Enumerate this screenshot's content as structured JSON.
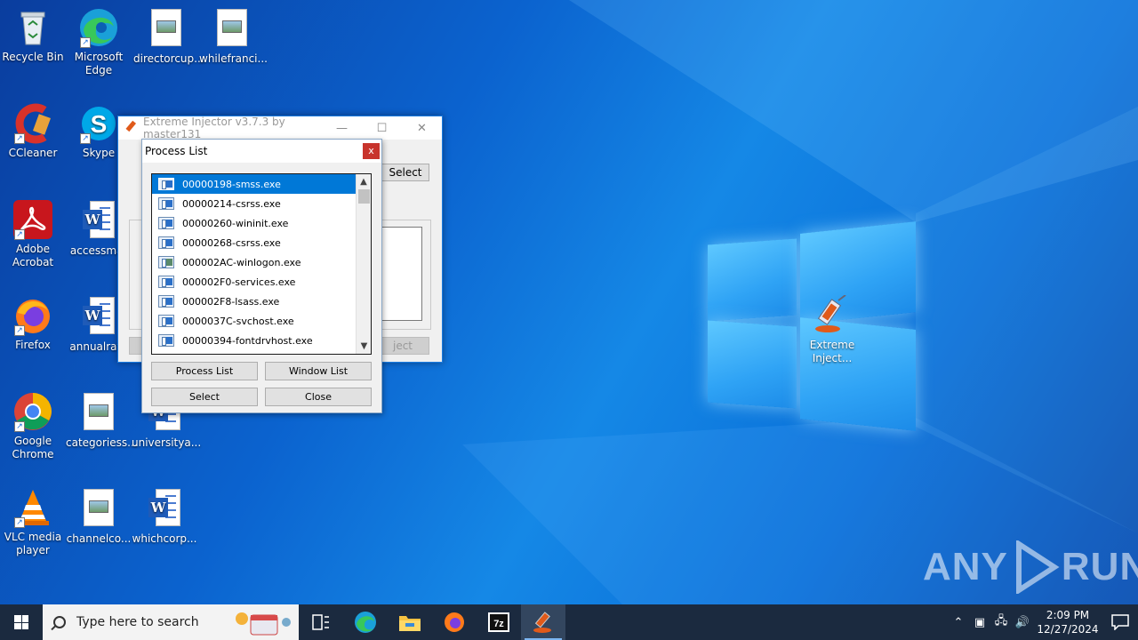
{
  "desktop": {
    "icons": [
      {
        "label": "Recycle Bin",
        "icon": "recycle-bin-icon"
      },
      {
        "label": "Microsoft Edge",
        "icon": "edge-icon"
      },
      {
        "label": "directorcup...",
        "icon": "image-file-icon"
      },
      {
        "label": "whilefranci...",
        "icon": "image-file-icon"
      },
      {
        "label": "CCleaner",
        "icon": "ccleaner-icon"
      },
      {
        "label": "Skype",
        "icon": "skype-icon"
      },
      {
        "label": "Adobe Acrobat",
        "icon": "acrobat-icon"
      },
      {
        "label": "accessmat",
        "icon": "word-doc-icon"
      },
      {
        "label": "Firefox",
        "icon": "firefox-icon"
      },
      {
        "label": "annualrate",
        "icon": "word-doc-icon"
      },
      {
        "label": "Google Chrome",
        "icon": "chrome-icon"
      },
      {
        "label": "categoriess...",
        "icon": "image-file-icon"
      },
      {
        "label": "universitya...",
        "icon": "word-doc-icon"
      },
      {
        "label": "VLC media player",
        "icon": "vlc-icon"
      },
      {
        "label": "channelco...",
        "icon": "image-file-icon"
      },
      {
        "label": "whichcorp...",
        "icon": "word-doc-icon"
      },
      {
        "label": "Extreme Inject...",
        "icon": "syringe-icon"
      }
    ]
  },
  "injector_window": {
    "title": "Extreme Injector v3.7.3 by master131",
    "select_label": "Select",
    "inject_label": "ject"
  },
  "process_dialog": {
    "title": "Process List",
    "close_glyph": "x",
    "processes": [
      "00000198-smss.exe",
      "00000214-csrss.exe",
      "00000260-wininit.exe",
      "00000268-csrss.exe",
      "000002AC-winlogon.exe",
      "000002F0-services.exe",
      "000002F8-lsass.exe",
      "0000037C-svchost.exe",
      "00000394-fontdrvhost.exe"
    ],
    "buttons": {
      "process_list": "Process List",
      "window_list": "Window List",
      "select": "Select",
      "close": "Close"
    }
  },
  "taskbar": {
    "search_placeholder": "Type here to search",
    "clock_time": "2:09 PM",
    "clock_date": "12/27/2024",
    "accent": "#0078d7"
  },
  "watermark": {
    "text_left": "ANY",
    "text_right": "RUN"
  }
}
